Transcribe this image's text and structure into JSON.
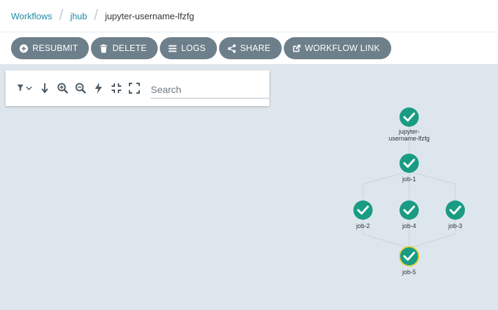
{
  "breadcrumb": {
    "items": [
      {
        "label": "Workflows"
      },
      {
        "label": "jhub"
      }
    ],
    "current": "jupyter-username-lfzfg"
  },
  "toolbar": {
    "buttons": [
      {
        "label": "RESUBMIT",
        "icon": "plus-circle-icon"
      },
      {
        "label": "DELETE",
        "icon": "trash-icon"
      },
      {
        "label": "LOGS",
        "icon": "list-icon"
      },
      {
        "label": "SHARE",
        "icon": "share-icon"
      },
      {
        "label": "WORKFLOW LINK",
        "icon": "external-link-icon"
      }
    ],
    "button_color": "#6d7f8b"
  },
  "graph_panel": {
    "icons": [
      "filter-icon",
      "chevron-down-icon",
      "arrow-down-icon",
      "zoom-in-icon",
      "zoom-out-icon",
      "bolt-icon",
      "compress-icon",
      "expand-icon"
    ],
    "search": {
      "placeholder": "Search",
      "value": ""
    }
  },
  "workflow": {
    "node_color": "#1a9c84",
    "nodes": [
      {
        "id": "root",
        "label": "jupyter-username-lfzfg",
        "status": "succeeded"
      },
      {
        "id": "job-1",
        "label": "job-1",
        "status": "succeeded"
      },
      {
        "id": "job-2",
        "label": "job-2",
        "status": "succeeded"
      },
      {
        "id": "job-4",
        "label": "job-4",
        "status": "succeeded"
      },
      {
        "id": "job-3",
        "label": "job-3",
        "status": "succeeded"
      },
      {
        "id": "job-5",
        "label": "job-5",
        "status": "succeeded",
        "selected": true
      }
    ],
    "edges": [
      [
        "root",
        "job-1"
      ],
      [
        "job-1",
        "job-2"
      ],
      [
        "job-1",
        "job-4"
      ],
      [
        "job-1",
        "job-3"
      ],
      [
        "job-2",
        "job-5"
      ],
      [
        "job-4",
        "job-5"
      ],
      [
        "job-3",
        "job-5"
      ]
    ]
  }
}
